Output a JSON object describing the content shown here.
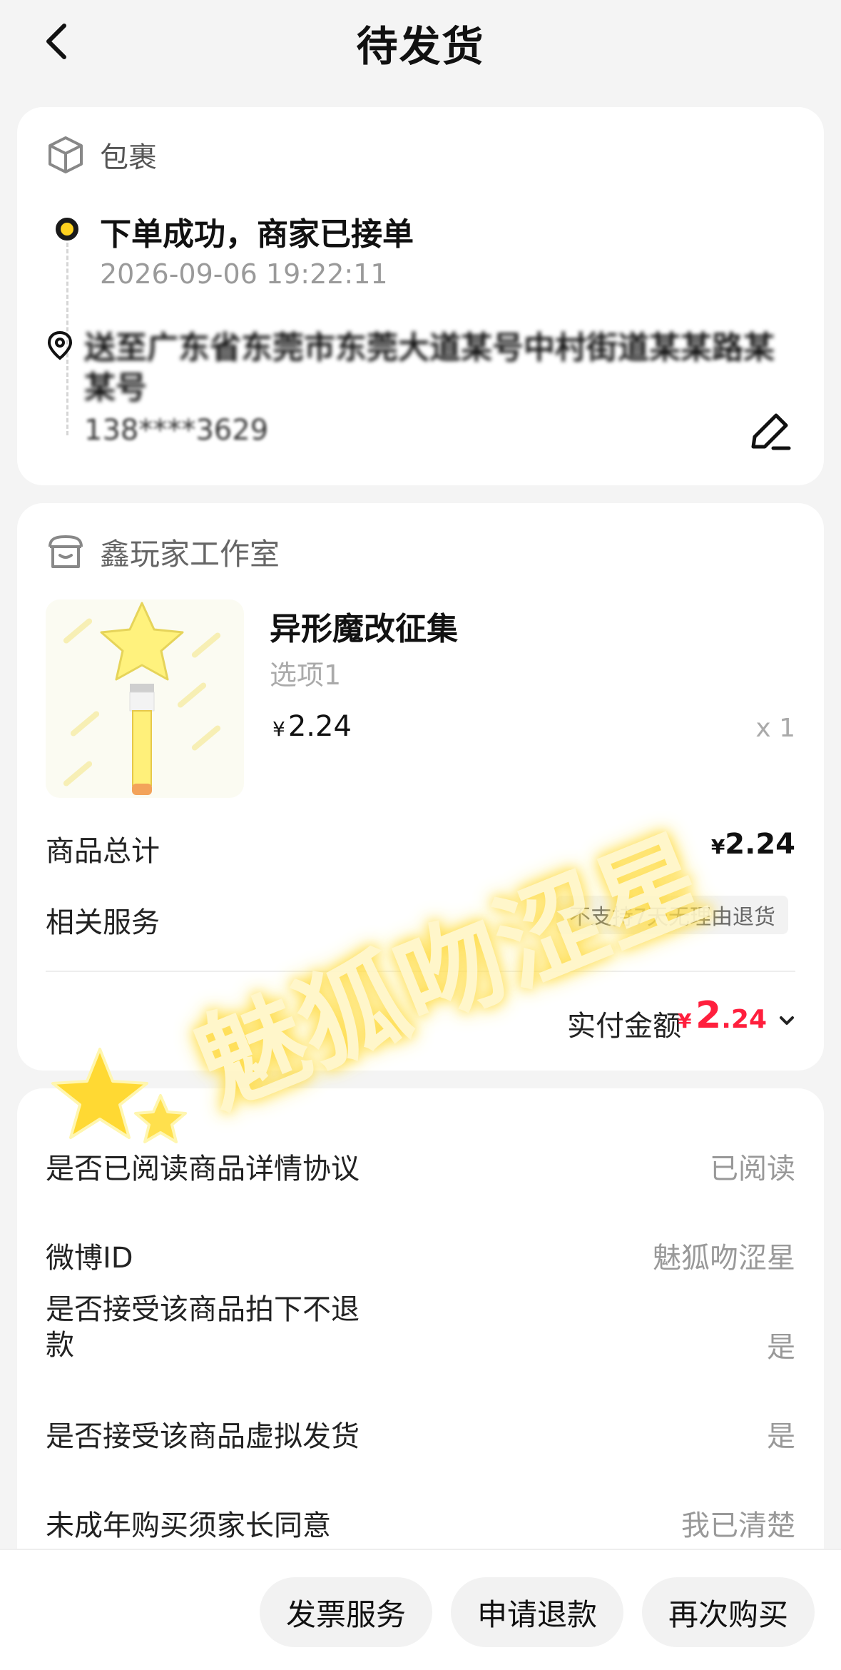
{
  "header": {
    "title": "待发货"
  },
  "package": {
    "label": "包裹",
    "status": "下单成功，商家已接单",
    "time": "2026-09-06 19:22:11",
    "address": "送至广东省东莞市东莞大道某号中村街道某某路某某号",
    "phone": "138****3629"
  },
  "shop": {
    "name": "鑫玩家工作室"
  },
  "product": {
    "name": "异形魔改征集",
    "option": "选项1",
    "currency": "¥",
    "price": "2.24",
    "qty": "x 1"
  },
  "summary": {
    "total_label": "商品总计",
    "total_currency": "¥",
    "total_value": "2.24",
    "service_label": "相关服务",
    "service_badge": "不支持7天无理由退货",
    "paid_label": "实付金额",
    "paid_currency": "¥",
    "paid_int": "2",
    "paid_dec": ".24"
  },
  "info_rows": [
    {
      "label": "是否已阅读商品详情协议",
      "value": "已阅读"
    },
    {
      "label": "微博ID",
      "value": "魅狐吻涩星"
    },
    {
      "label": "是否接受该商品拍下不退\n款",
      "value": "是"
    },
    {
      "label": "是否接受该商品虚拟发货",
      "value": "是"
    },
    {
      "label": "未成年购买须家长同意",
      "value": "我已清楚"
    }
  ],
  "actions": {
    "invoice": "发票服务",
    "refund": "申请退款",
    "rebuy": "再次购买"
  },
  "watermark": {
    "text": "魅狐吻涩星"
  },
  "colors": {
    "accent_yellow": "#ffd21f",
    "price_red": "#ff1f3d",
    "background": "#f4f4f4"
  }
}
